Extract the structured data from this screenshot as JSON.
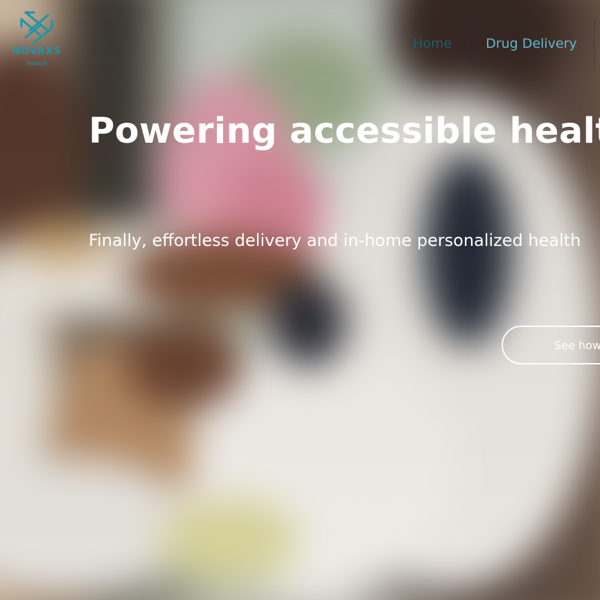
{
  "brand": {
    "name": "NOVAXS",
    "tagline": "biotech",
    "color": "#1f95a8",
    "logo_icon": "crossed-arrows-logo-icon"
  },
  "nav": {
    "items": [
      {
        "label": "Home",
        "active": true
      },
      {
        "label": "Drug Delivery",
        "active": false
      }
    ]
  },
  "hero": {
    "headline": "Powering accessible healthcare",
    "subheadline": "Finally, effortless delivery and in-home personalized health",
    "cta_label": "See how"
  },
  "colors": {
    "nav_active": "#1f5d6e",
    "nav_link": "#5fb8cd",
    "hero_text": "#ffffff"
  }
}
